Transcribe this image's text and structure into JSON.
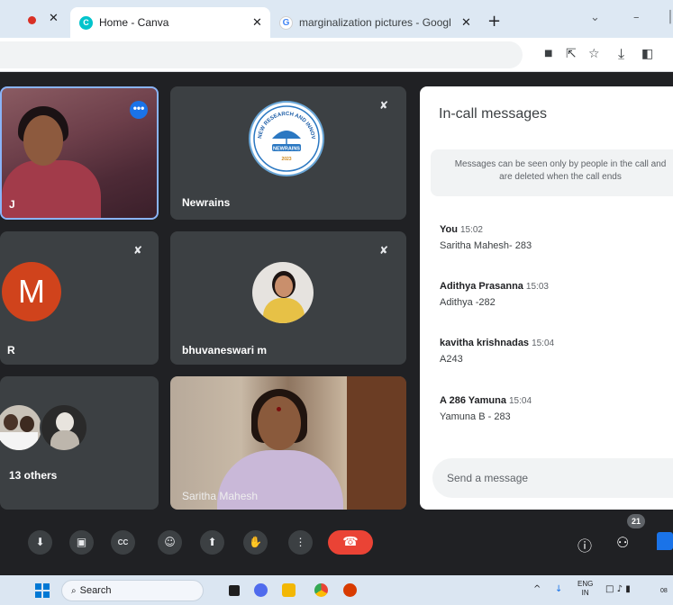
{
  "browser": {
    "tabs": [
      {
        "title": "Home - Canva",
        "favicon": "canva-icon",
        "favicon_text": "C",
        "active": true
      },
      {
        "title": "marginalization pictures - Google S",
        "favicon": "google-icon",
        "favicon_text": "G",
        "active": false
      }
    ],
    "close_glyph": "✕",
    "new_tab_glyph": "+",
    "window_controls": {
      "dropdown": "⌄",
      "minimize": "–",
      "maximize": "│"
    },
    "toolbar_icons": [
      "camera-icon",
      "share-icon",
      "star-icon",
      "download-icon",
      "sidepanel-icon"
    ],
    "toolbar_glyphs": {
      "camera": "■",
      "share": "⇱",
      "star": "☆",
      "download": "⤓",
      "sidepanel": "◧"
    },
    "recording_color": "#d93025"
  },
  "meet": {
    "tiles": [
      {
        "name": "J",
        "type": "video",
        "pinned_highlight": true,
        "more_glyph": "•••"
      },
      {
        "name": "Newrains",
        "type": "logo",
        "muted": true,
        "logo_text_top": "NEW RESEARCH AND INNOVATION SOCIETY",
        "logo_badge": "NEWRAINS",
        "logo_year": "2023"
      },
      {
        "name": "R",
        "type": "avatar",
        "avatar_letter": "M",
        "avatar_color": "#d0431c",
        "muted": true
      },
      {
        "name": "bhuvaneswari m",
        "type": "avatar-photo",
        "muted": true
      },
      {
        "name": "13 others",
        "type": "group"
      },
      {
        "name": "Saritha Mahesh",
        "type": "video"
      }
    ],
    "mute_glyph": "✘",
    "messages_panel": {
      "title": "In-call messages",
      "notice": "Messages can be seen only by people in the call and are deleted when the call ends",
      "messages": [
        {
          "sender": "You",
          "time": "15:02",
          "text": "Saritha Mahesh- 283"
        },
        {
          "sender": "Adithya Prasanna",
          "time": "15:03",
          "text": "Adithya -282"
        },
        {
          "sender": "kavitha krishnadas",
          "time": "15:04",
          "text": "A243"
        },
        {
          "sender": "A 286 Yamuna",
          "time": "15:04",
          "text": "Yamuna B - 283"
        }
      ],
      "input_placeholder": "Send a message"
    },
    "controls": {
      "buttons": [
        {
          "name": "mic-button",
          "icon": "mic-icon",
          "glyph": "⬇"
        },
        {
          "name": "camera-button",
          "icon": "camera-icon",
          "glyph": "▣"
        },
        {
          "name": "captions-button",
          "icon": "captions-icon",
          "glyph": "CC"
        },
        {
          "name": "reactions-button",
          "icon": "emoji-icon",
          "glyph": "☺"
        },
        {
          "name": "present-button",
          "icon": "present-icon",
          "glyph": "⬆"
        },
        {
          "name": "raise-hand-button",
          "icon": "hand-icon",
          "glyph": "✋"
        },
        {
          "name": "more-options-button",
          "icon": "more-vert-icon",
          "glyph": "⋮"
        }
      ],
      "end_call_glyph": "☎",
      "end_call_color": "#ea4335",
      "info_glyph": "ⓘ",
      "people_glyph": "⚇",
      "participant_count": "21",
      "accent_color": "#1a73e8"
    }
  },
  "taskbar": {
    "search_label": "Search",
    "search_glyph": "⌕",
    "apps": [
      "file-explorer-icon",
      "meet-icon",
      "folder-icon",
      "chrome-icon",
      "office-icon"
    ],
    "tray": {
      "chevron": "^",
      "mic": "↓",
      "lang_top": "ENG",
      "lang_bottom": "IN",
      "status": "□ ♪ ▮",
      "clock": "08"
    }
  }
}
